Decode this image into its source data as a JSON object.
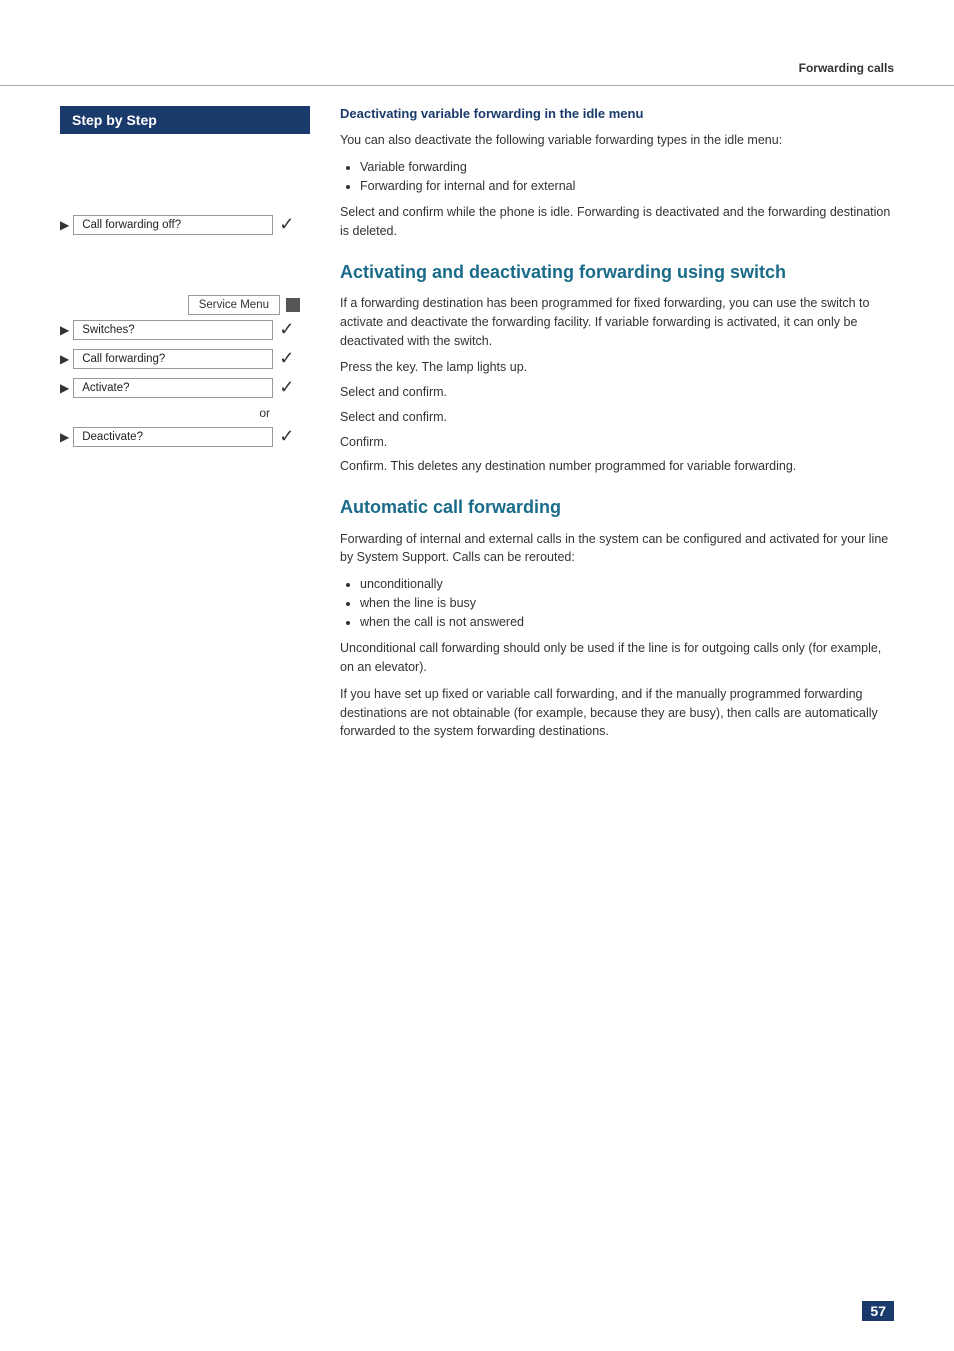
{
  "header": {
    "title": "Forwarding calls"
  },
  "left_col": {
    "step_by_step_label": "Step by Step",
    "step1": {
      "arrow": "▶",
      "label": "Call forwarding off?",
      "check": "✓"
    },
    "service_menu": {
      "label": "Service Menu",
      "square": ""
    },
    "step2": {
      "arrow": "▶",
      "label": "Switches?",
      "check": "✓"
    },
    "step3": {
      "arrow": "▶",
      "label": "Call forwarding?",
      "check": "✓"
    },
    "step4": {
      "arrow": "▶",
      "label": "Activate?",
      "check": "✓"
    },
    "or_label": "or",
    "step5": {
      "arrow": "▶",
      "label": "Deactivate?",
      "check": "✓"
    }
  },
  "right_col": {
    "section1": {
      "title": "Deactivating variable forwarding in the idle menu",
      "para1": "You can also deactivate the following variable forwarding types in the idle menu:",
      "bullets": [
        "Variable forwarding",
        "Forwarding for internal and for external"
      ],
      "instruction1": "Select and confirm while the phone is idle. Forwarding is deactivated and the forwarding destination is deleted."
    },
    "section2": {
      "title": "Activating and deactivating forwarding using switch",
      "para1": "If a forwarding destination has been programmed for fixed forwarding, you can use the switch to activate and deactivate the forwarding facility. If variable forwarding is activated, it can only be deactivated with the switch.",
      "instruction1": "Press the key. The lamp lights up.",
      "instruction2": "Select and confirm.",
      "instruction3": "Select and confirm.",
      "instruction4": "Confirm.",
      "instruction5": "Confirm. This deletes any destination number programmed for variable forwarding."
    },
    "section3": {
      "title": "Automatic call forwarding",
      "para1": "Forwarding of internal and external calls in the system can be configured and activated for your line by System Support. Calls can be rerouted:",
      "bullets": [
        "unconditionally",
        "when the line is busy",
        "when the call is not answered"
      ],
      "para2": "Unconditional call forwarding should only be used if the line is for outgoing calls only (for example, on an elevator).",
      "para3": "If you have set up fixed or variable call forwarding, and if the manually programmed forwarding destinations are not obtainable (for example, because they are busy), then calls are automatically forwarded to the system forwarding destinations."
    }
  },
  "page_number": "57"
}
